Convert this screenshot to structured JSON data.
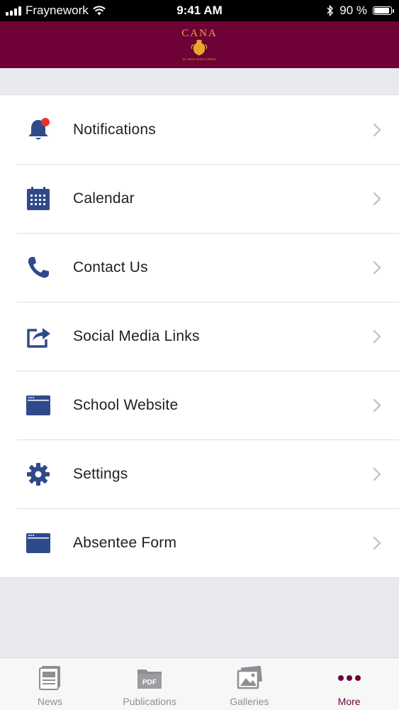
{
  "status_bar": {
    "carrier": "Fraynework",
    "time": "9:41 AM",
    "battery_percent": "90 %",
    "battery_level": 0.9
  },
  "header": {
    "logo_text": "CANA",
    "logo_motto": "IN OMNI BONA OPERA",
    "logo_color": "#e9a72a",
    "brand_color": "#6e0136"
  },
  "menu": {
    "items": [
      {
        "label": "Notifications",
        "icon": "bell-icon",
        "badge": true
      },
      {
        "label": "Calendar",
        "icon": "calendar-icon"
      },
      {
        "label": "Contact Us",
        "icon": "phone-icon"
      },
      {
        "label": "Social Media Links",
        "icon": "share-icon"
      },
      {
        "label": "School Website",
        "icon": "browser-window-icon"
      },
      {
        "label": "Settings",
        "icon": "gear-icon"
      },
      {
        "label": "Absentee Form",
        "icon": "browser-window-icon"
      }
    ],
    "icon_color": "#2f4a8a",
    "badge_color": "#e8322c"
  },
  "tab_bar": {
    "tabs": [
      {
        "label": "News",
        "icon": "news-icon",
        "active": false
      },
      {
        "label": "Publications",
        "icon": "pdf-folder-icon",
        "icon_text": "PDF",
        "active": false
      },
      {
        "label": "Galleries",
        "icon": "gallery-icon",
        "active": false
      },
      {
        "label": "More",
        "icon": "more-dots-icon",
        "active": true
      }
    ]
  }
}
